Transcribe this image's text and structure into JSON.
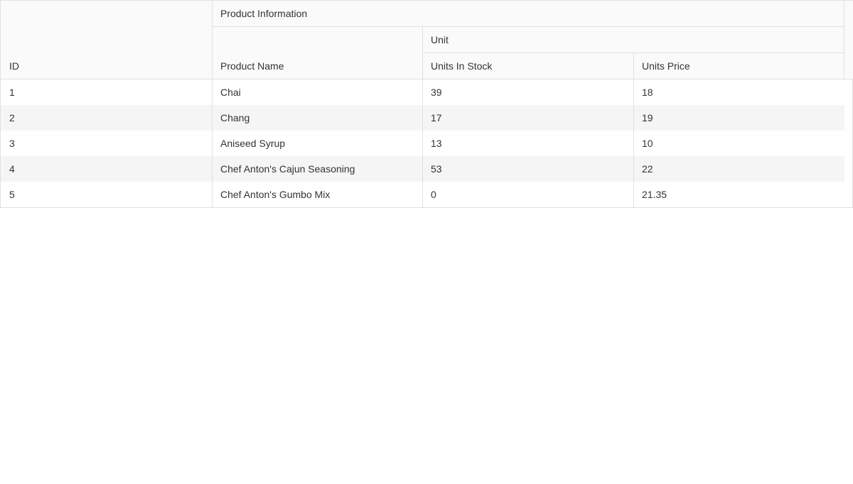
{
  "table": {
    "header": {
      "group_label": "Product Information",
      "subgroup_label": "Unit",
      "columns": [
        "ID",
        "Product Name",
        "Units In Stock",
        "Units Price"
      ]
    },
    "rows": [
      [
        "1",
        "Chai",
        "39",
        "18"
      ],
      [
        "2",
        "Chang",
        "17",
        "19"
      ],
      [
        "3",
        "Aniseed Syrup",
        "13",
        "10"
      ],
      [
        "4",
        "Chef Anton's Cajun Seasoning",
        "53",
        "22"
      ],
      [
        "5",
        "Chef Anton's Gumbo Mix",
        "0",
        "21.35"
      ]
    ]
  }
}
